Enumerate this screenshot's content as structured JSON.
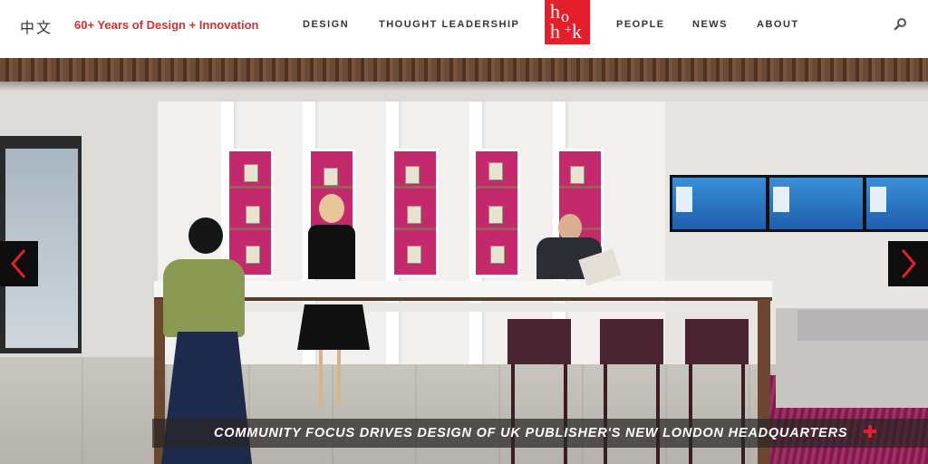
{
  "header": {
    "lang_label": "中文",
    "tagline": "60+ Years of Design + Innovation",
    "nav": {
      "design": "DESIGN",
      "thought_leadership": "THOUGHT LEADERSHIP",
      "people": "PEOPLE",
      "news": "NEWS",
      "about": "ABOUT"
    },
    "logo": {
      "l1": "h",
      "l2": "o",
      "l3": "h",
      "l4": "k"
    },
    "search_icon": "search-icon"
  },
  "hero": {
    "caption": "COMMUNITY FOCUS DRIVES DESIGN OF UK PUBLISHER'S NEW LONDON HEADQUARTERS",
    "prev_icon": "chevron-left-icon",
    "next_icon": "chevron-right-icon",
    "plus_icon": "plus-icon"
  },
  "colors": {
    "brand_red": "#e41e2b",
    "tagline_red": "#d92d2d",
    "caption_bg": "#282624",
    "arrow_red": "#e41e2b"
  }
}
